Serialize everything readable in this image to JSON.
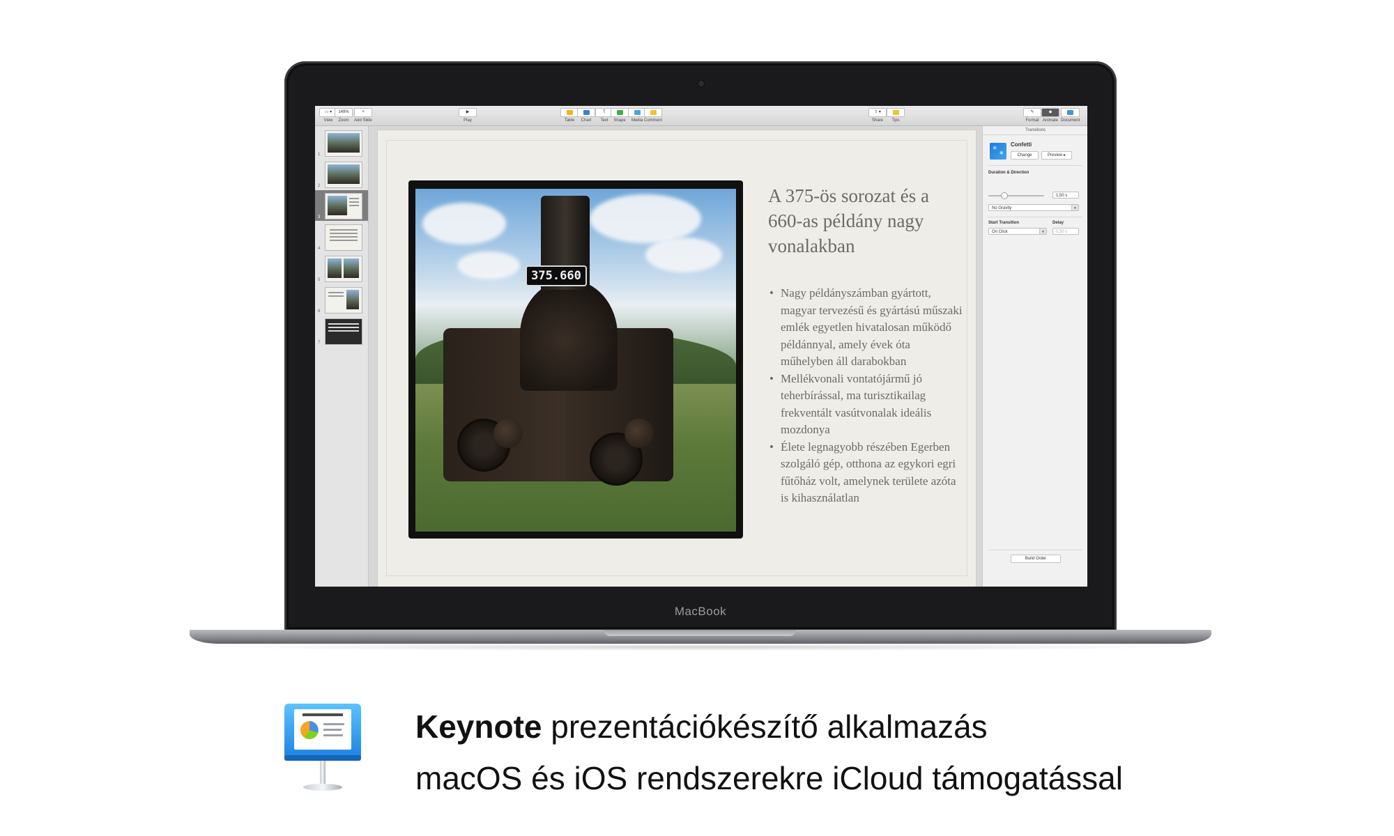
{
  "laptop": {
    "brand_label": "MacBook"
  },
  "toolbar": {
    "view": "View",
    "zoom": "Zoom",
    "zoom_value": "149%",
    "add_slide": "Add Slide",
    "play": "Play",
    "table": "Table",
    "chart": "Chart",
    "text": "Text",
    "shape": "Shape",
    "media": "Media",
    "comment": "Comment",
    "share": "Share",
    "tips": "Tips",
    "format": "Format",
    "animate": "Animate",
    "document": "Document"
  },
  "navigator": {
    "slides": [
      {
        "number": "1"
      },
      {
        "number": "2"
      },
      {
        "number": "3"
      },
      {
        "number": "4"
      },
      {
        "number": "5"
      },
      {
        "number": "6"
      },
      {
        "number": "7"
      }
    ],
    "selected_index": 3
  },
  "slide": {
    "title": "A 375-ös sorozat és a 660-as példány nagy vonalakban",
    "plate_number": "375.660",
    "bullets": [
      "Nagy példányszámban gyártott, magyar tervezésű és gyártású műszaki emlék egyetlen hivatalosan működő példánnyal, amely évek óta műhelyben áll darabokban",
      "Mellékvonali vontatójármű jó teherbírással, ma turisztikailag frekventált vasútvonalak ideális mozdonya",
      "Élete legnagyobb részében Egerben szolgáló gép, otthona az egykori egri fűtőház volt, amelynek területe azóta is kihasználatlan"
    ]
  },
  "inspector": {
    "header": "Transitions",
    "effect_name": "Confetti",
    "change": "Change",
    "preview": "Preview ▸",
    "duration_heading": "Duration & Direction",
    "duration_value": "1,50 s",
    "direction_value": "No Gravity",
    "start_heading": "Start Transition",
    "delay_heading": "Delay",
    "start_value": "On Click",
    "delay_value": "0,50 s",
    "build_order": "Build Order"
  },
  "caption": {
    "app_name": "Keynote",
    "line1_rest": " prezentációkészítő alkalmazás",
    "line2": "macOS és iOS rendszerekre iCloud támogatással"
  },
  "icons": [
    "keynote-app-icon",
    "play-icon",
    "table-icon",
    "chart-icon",
    "text-icon",
    "shape-icon",
    "media-icon",
    "comment-icon",
    "share-icon",
    "tips-icon",
    "format-icon",
    "animate-icon",
    "document-icon",
    "confetti-icon"
  ]
}
